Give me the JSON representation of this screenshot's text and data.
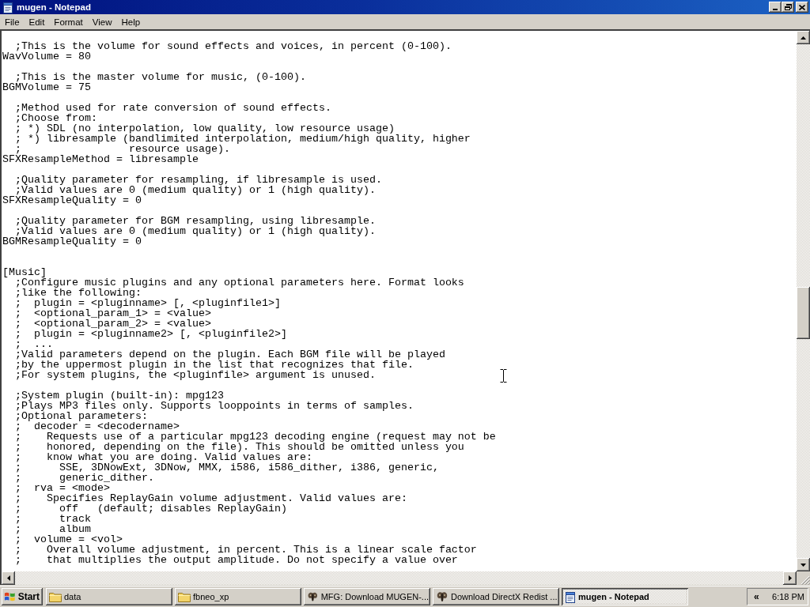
{
  "window": {
    "title": "mugen - Notepad",
    "maximized": true
  },
  "menu_bar": [
    "File",
    "Edit",
    "Format",
    "View",
    "Help"
  ],
  "document": {
    "blocks": [
      {
        "kind": "setting",
        "lines": [
          "  ;This is the volume for sound effects and voices, in percent (0-100).",
          "WavVolume = 80"
        ]
      },
      {
        "kind": "setting",
        "lines": [
          "  ;This is the master volume for music, (0-100).",
          "BGMVolume = 75"
        ]
      },
      {
        "kind": "setting",
        "lines": [
          "  ;Method used for rate conversion of sound effects.",
          "  ;Choose from:",
          "  ; *) SDL (no interpolation, low quality, low resource usage)",
          "  ; *) libresample (bandlimited interpolation, medium/high quality, higher",
          "  ;                 resource usage).",
          "SFXResampleMethod = libresample"
        ]
      },
      {
        "kind": "setting",
        "lines": [
          "  ;Quality parameter for resampling, if libresample is used.",
          "  ;Valid values are 0 (medium quality) or 1 (high quality).",
          "SFXResampleQuality = 0"
        ]
      },
      {
        "kind": "setting",
        "lines": [
          "  ;Quality parameter for BGM resampling, using libresample.",
          "  ;Valid values are 0 (medium quality) or 1 (high quality).",
          "BGMResampleQuality = 0"
        ]
      },
      {
        "kind": "section",
        "lines": [
          "[Music]",
          "  ;Configure music plugins and any optional parameters here. Format looks",
          "  ;like the following:",
          "  ;  plugin = <pluginname> [, <pluginfile1>]",
          "  ;  <optional_param_1> = <value>",
          "  ;  <optional_param_2> = <value>",
          "  ;  plugin = <pluginname2> [, <pluginfile2>]",
          "  ;  ...",
          "  ;Valid parameters depend on the plugin. Each BGM file will be played",
          "  ;by the uppermost plugin in the list that recognizes that file.",
          "  ;For system plugins, the <pluginfile> argument is unused."
        ]
      },
      {
        "kind": "setting",
        "lines": [
          "  ;System plugin (built-in): mpg123",
          "  ;Plays MP3 files only. Supports looppoints in terms of samples.",
          "  ;Optional parameters:",
          "  ;  decoder = <decodername>",
          "  ;    Requests use of a particular mpg123 decoding engine (request may not be",
          "  ;    honored, depending on the file). This should be omitted unless you",
          "  ;    know what you are doing. Valid values are:",
          "  ;      SSE, 3DNowExt, 3DNow, MMX, i586, i586_dither, i386, generic,",
          "  ;      generic_dither.",
          "  ;  rva = <mode>",
          "  ;    Specifies ReplayGain volume adjustment. Valid values are:",
          "  ;      off   (default; disables ReplayGain)",
          "  ;      track",
          "  ;      album",
          "  ;  volume = <vol>",
          "  ;    Overall volume adjustment, in percent. This is a linear scale factor",
          "  ;    that multiplies the output amplitude. Do not specify a value over"
        ]
      }
    ]
  },
  "taskbar": {
    "start_label": "Start",
    "tasks": [
      {
        "label": "data",
        "kind": "folder",
        "selected": false
      },
      {
        "label": "fbneo_xp",
        "kind": "folder",
        "selected": false
      },
      {
        "label": "MFG: Download MUGEN-...",
        "kind": "browser",
        "selected": false
      },
      {
        "label": "Download DirectX Redist ...",
        "kind": "browser",
        "selected": false
      },
      {
        "label": "mugen - Notepad",
        "kind": "notepad",
        "selected": true
      }
    ],
    "tray": {
      "expand": "«",
      "clock": "6:18 PM"
    }
  }
}
